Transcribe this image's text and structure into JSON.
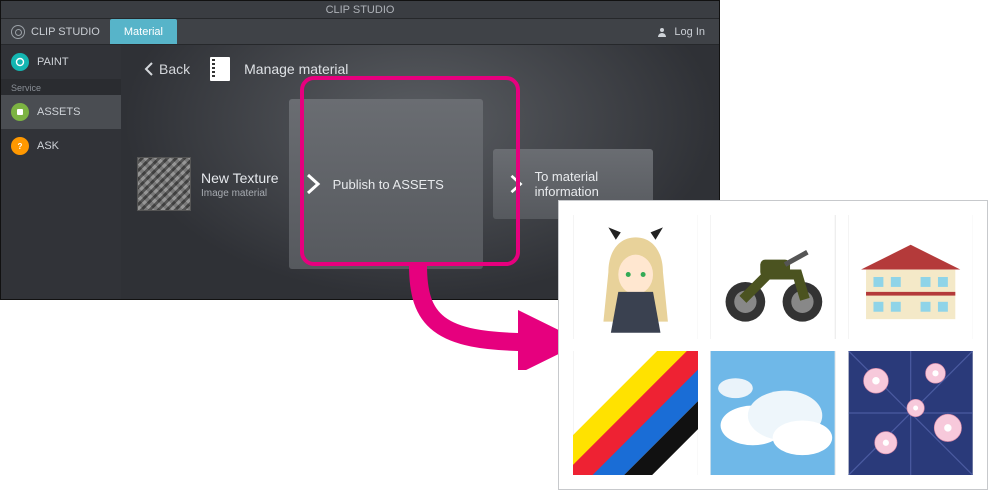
{
  "titlebar": "CLIP STUDIO",
  "topbar": {
    "brand": "CLIP STUDIO",
    "active_tab": "Material",
    "login": "Log In"
  },
  "sidebar": {
    "items": [
      {
        "label": "PAINT"
      },
      {
        "label": "ASSETS"
      },
      {
        "label": "ASK"
      }
    ],
    "service_header": "Service"
  },
  "crumb": {
    "back": "Back",
    "title": "Manage material"
  },
  "material": {
    "name": "New Texture",
    "type": "Image material"
  },
  "actions": {
    "publish": "Publish to ASSETS",
    "info": "To material information"
  },
  "gallery_items": [
    "anime-girl",
    "motorcycle",
    "building",
    "paint-stripes",
    "clouds",
    "floral-pattern"
  ],
  "colors": {
    "accent": "#e6007e",
    "tab": "#57b4c9"
  }
}
